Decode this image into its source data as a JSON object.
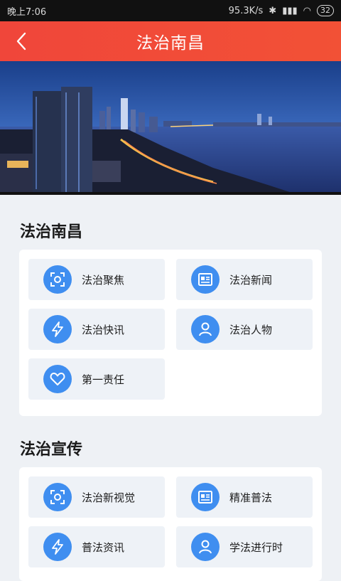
{
  "status_bar": {
    "time": "晚上7:06",
    "speed": "95.3K/s",
    "battery": "32"
  },
  "app_bar": {
    "title": "法治南昌"
  },
  "sections": [
    {
      "title": "法治南昌",
      "items": [
        {
          "label": "法治聚焦",
          "icon": "focus-icon"
        },
        {
          "label": "法治新闻",
          "icon": "newspaper-icon"
        },
        {
          "label": "法治快讯",
          "icon": "lightning-icon"
        },
        {
          "label": "法治人物",
          "icon": "person-icon"
        },
        {
          "label": "第一责任",
          "icon": "heart-icon"
        }
      ]
    },
    {
      "title": "法治宣传",
      "items": [
        {
          "label": "法治新视觉",
          "icon": "focus-icon"
        },
        {
          "label": "精准普法",
          "icon": "newspaper-icon"
        },
        {
          "label": "普法资讯",
          "icon": "lightning-icon"
        },
        {
          "label": "学法进行时",
          "icon": "person-icon"
        }
      ]
    }
  ],
  "colors": {
    "app_bar": "#f0463a",
    "icon_bg": "#3f8ef0",
    "tile_bg": "#eef2f7"
  }
}
